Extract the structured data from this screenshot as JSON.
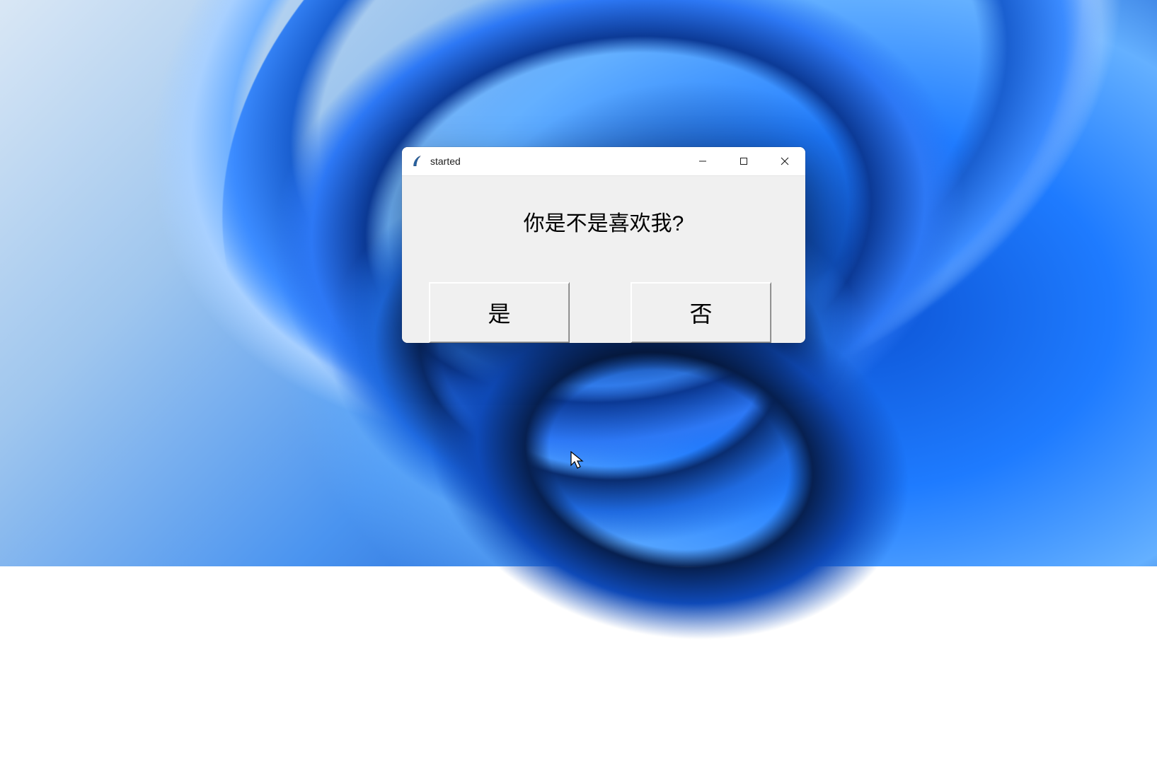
{
  "window": {
    "title": "started",
    "icon_name": "tkinter-feather-icon"
  },
  "dialog": {
    "question": "你是不是喜欢我?",
    "yes_label": "是",
    "no_label": "否"
  },
  "controls": {
    "minimize_name": "minimize-icon",
    "maximize_name": "maximize-icon",
    "close_name": "close-icon"
  }
}
